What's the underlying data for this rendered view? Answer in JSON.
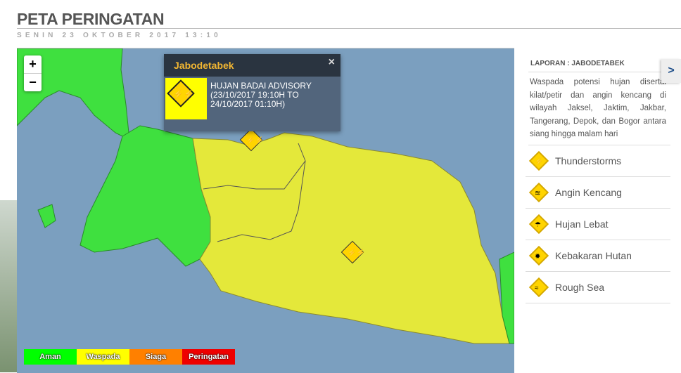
{
  "header": {
    "title": "PETA PERINGATAN",
    "date": "SENIN 23 OKTOBER 2017 13:10"
  },
  "map": {
    "zoom_in": "+",
    "zoom_out": "−",
    "popup": {
      "title": "Jabodetabek",
      "close": "×",
      "icon": "thunderstorm-icon",
      "text": "HUJAN BADAI ADVISORY (23/10/2017 19:10H TO 24/10/2017 01:10H)"
    },
    "legend": [
      {
        "label": "Aman",
        "color": "#00ff00"
      },
      {
        "label": "Waspada",
        "color": "#ffff00"
      },
      {
        "label": "Siaga",
        "color": "#ff8000"
      },
      {
        "label": "Peringatan",
        "color": "#ee0000"
      }
    ]
  },
  "panel": {
    "title": "LAPORAN : JABODETABEK",
    "expand": ">",
    "description": "Waspada potensi hujan disertai kilat/petir dan angin kencang di wilayah Jaksel, Jaktim, Jakbar, Tangerang, Depok, dan Bogor antara siang hingga malam hari",
    "items": [
      {
        "label": "Thunderstorms",
        "icon": "thunderstorm-icon"
      },
      {
        "label": "Angin Kencang",
        "icon": "wind-icon"
      },
      {
        "label": "Hujan Lebat",
        "icon": "heavy-rain-icon"
      },
      {
        "label": "Kebakaran Hutan",
        "icon": "forest-fire-icon"
      },
      {
        "label": "Rough Sea",
        "icon": "rough-sea-icon"
      }
    ]
  }
}
